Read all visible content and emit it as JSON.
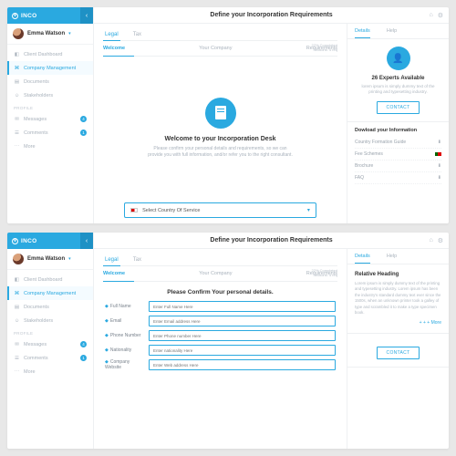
{
  "brand": "INCO",
  "user": {
    "name": "Emma Watson"
  },
  "nav": {
    "items": [
      {
        "label": "Client Dashboard"
      },
      {
        "label": "Company Management"
      },
      {
        "label": "Documents"
      },
      {
        "label": "Stakeholders"
      }
    ],
    "section": "PROFILE",
    "items2": [
      {
        "label": "Messages",
        "badge": "4"
      },
      {
        "label": "Comments",
        "badge": "1"
      },
      {
        "label": "More"
      }
    ]
  },
  "page_title": "Define your Incorporation Requirements",
  "tabs1": {
    "a": "Legal",
    "b": "Tax"
  },
  "tabs2": {
    "a": "Welcome",
    "b": "Your Company",
    "c": "Requirements"
  },
  "meta": {
    "l1": "22% Completed",
    "l2": "Sections: 4 req"
  },
  "hero": {
    "title": "Welcome to your Incorporation Desk",
    "body": "Please confirm your personal details and requirements, so we can provide you with full information, and/or refer you to the right consultant."
  },
  "select_label": "Select Country Of Service",
  "right": {
    "tab_a": "Details",
    "tab_b": "Help",
    "experts_title": "26 Experts Available",
    "experts_body": "lorem ipsum is simply dummy text of the printing and typesetting industry.",
    "contact": "CONTACT",
    "dl_title": "Dowload your Information",
    "dl": [
      "Country Formation Guide",
      "Fee Schemes",
      "Brochure",
      "FAQ"
    ]
  },
  "form": {
    "title": "Please Confirm Your personal details.",
    "fields": {
      "fullname": {
        "label": "Full Name",
        "ph": "Enter Full Name Here"
      },
      "email": {
        "label": "Email",
        "ph": "Enter Email address Here"
      },
      "phone": {
        "label": "Phone Number",
        "ph": "Enter Phone number Here"
      },
      "nat": {
        "label": "Nationality",
        "ph": "Enter nationality Here"
      },
      "web": {
        "label": "Company Website",
        "ph": "Enter Web address Here"
      }
    }
  },
  "rel": {
    "title": "Relative Heading",
    "body": "Lorem ipsum is simply dummy text of the printing and typesetting industry. Lorem ipsum has been the industry's standard dummy text ever since the 1500s, when an unknown printer took a galley of type and scrambled it to make a type specimen book.",
    "more": "+ + +  More"
  }
}
